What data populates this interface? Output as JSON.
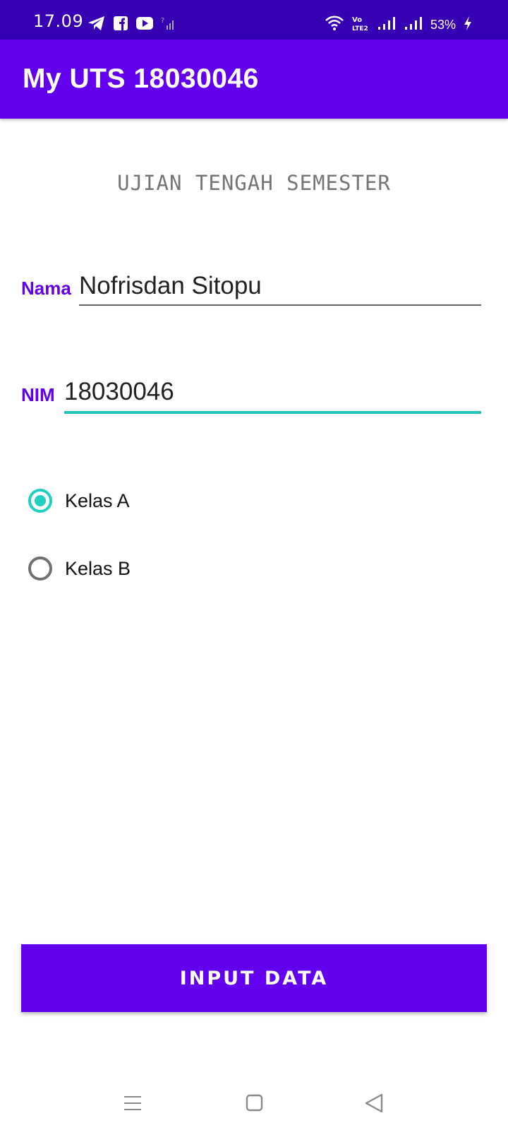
{
  "status_bar": {
    "time": "17.09",
    "battery": "53%",
    "left_icons": [
      "telegram-icon",
      "facebook-icon",
      "youtube-icon",
      "signal-unknown-icon"
    ],
    "right_icons": [
      "wifi-icon",
      "volte-icon",
      "signal-icon",
      "signal-icon",
      "battery-charging-icon"
    ]
  },
  "app_bar": {
    "title": "My UTS 18030046"
  },
  "form": {
    "heading": "UJIAN TENGAH SEMESTER",
    "nama_label": "Nama",
    "nama_value": "Nofrisdan Sitopu",
    "nim_label": "NIM",
    "nim_value": "18030046",
    "radio_options": [
      {
        "label": "Kelas A",
        "checked": true
      },
      {
        "label": "Kelas B",
        "checked": false
      }
    ],
    "button_label": "INPUT DATA"
  },
  "nav_bar": {
    "icons": [
      "menu-icon",
      "home-icon",
      "back-icon"
    ]
  },
  "colors": {
    "status_bar": "#3700b3",
    "primary": "#6200ee",
    "accent": "#20c5b7",
    "label": "#6200ee"
  }
}
